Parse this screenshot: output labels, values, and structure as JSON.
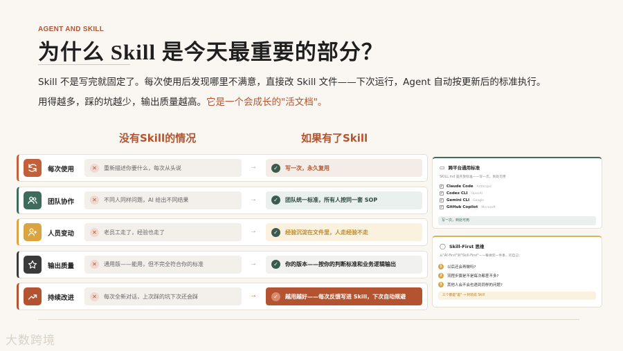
{
  "slide": {
    "eyebrow": "AGENT AND SKILL",
    "title": "为什么 Skill 是今天最重要的部分？",
    "para1": "Skill 不是写完就固定了。每次使用后发现哪里不满意，直接改 Skill 文件——下次运行，Agent 自动按更新后的标准执行。",
    "para2_plain": "用得越多，踩的坑越少，输出质量越高。",
    "para2_highlight": "它是一个会成长的\"活文档\"。"
  },
  "columns": {
    "left_head": "没有Skill的情况",
    "right_head": "如果有了Skill"
  },
  "rows": [
    {
      "label": "每次使用",
      "bad": "重新描述你要什么，每次从头说",
      "good": "写一次，永久复用",
      "icon": "refresh-icon",
      "color": "#c2603a",
      "good_bg": "#f4ece6",
      "good_fg": "#b4532f",
      "check_bg": "#3d5a4e"
    },
    {
      "label": "团队协作",
      "bad": "不同人同样问题，AI 给出不同结果",
      "good": "团队统一标准，所有人按同一套 SOP",
      "icon": "users-icon",
      "color": "#3d6b5c",
      "good_bg": "#eaf0ed",
      "good_fg": "#2f4a3f",
      "check_bg": "#3d5a4e"
    },
    {
      "label": "人员变动",
      "bad": "老员工走了，经验也走了",
      "good": "经验沉淀在文件里，人走经验不走",
      "icon": "user-plus-icon",
      "color": "#d9a441",
      "good_bg": "#faf1df",
      "good_fg": "#c08a25",
      "check_bg": "#3d5a4e"
    },
    {
      "label": "输出质量",
      "bad": "通用版——能用，但不完全符合你的标准",
      "good": "你的版本——按你的判断标准和业务逻辑输出",
      "icon": "star-icon",
      "color": "#3a3a3a",
      "good_bg": "#f1f1f0",
      "good_fg": "#222222",
      "check_bg": "#3d5a4e"
    },
    {
      "label": "持续改进",
      "bad": "每次全新对话，上次踩的坑下次还会踩",
      "good": "越用越好——每次反馈写进 Skill，下次自动规避",
      "icon": "trend-up-icon",
      "color": "#b4532f",
      "good_bg": "#b4532f",
      "good_fg": "#ffffff",
      "check_bg": "#d98a6c"
    }
  ],
  "card1": {
    "title": "跨平台通用标准",
    "sub": "SKILL.md 是开放标准——写一次，到处可用",
    "tools": [
      {
        "name": "Claude Code",
        "vendor": "Anthropic"
      },
      {
        "name": "Codex CLI",
        "vendor": "OpenAI"
      },
      {
        "name": "Gemini CLI",
        "vendor": "Google"
      },
      {
        "name": "GitHub Copilot",
        "vendor": "Microsoft"
      }
    ],
    "foot": "写一次，到处可用"
  },
  "card2": {
    "title": "Skill-First 思维",
    "sub": "从\"AI-First\"到\"Skill-First\"——每做完一件事，问自己：",
    "questions": [
      "以后还会再做吗?",
      "流程步骤是不是每次都差不多?",
      "其他人会不会也遇到同样的问题?"
    ],
    "foot": "三个都是\"是\" → 封装成 Skill"
  },
  "watermark": "大数跨境"
}
